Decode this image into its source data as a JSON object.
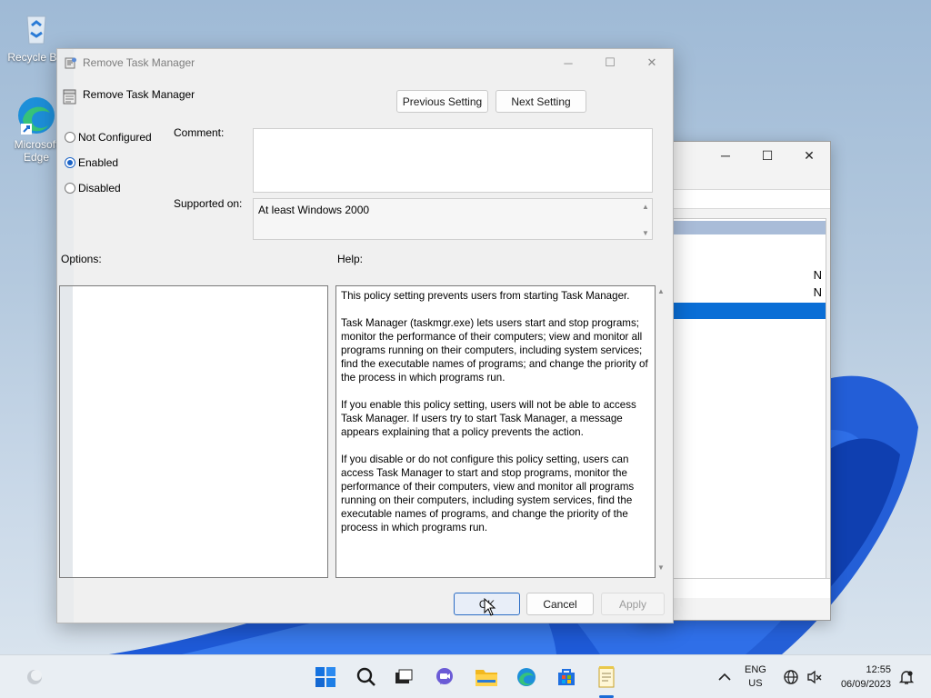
{
  "desktop": {
    "icons": [
      {
        "label": "Recycle Bin",
        "icon": "recycle-bin-icon"
      },
      {
        "label": "Microsoft Edge",
        "icon": "edge-icon"
      }
    ]
  },
  "background_window": {
    "rows": [
      "N",
      "N"
    ]
  },
  "dialog": {
    "title": "Remove Task Manager",
    "header_label": "Remove Task Manager",
    "buttons": {
      "previous": "Previous Setting",
      "next": "Next Setting",
      "ok": "OK",
      "cancel": "Cancel",
      "apply": "Apply"
    },
    "radios": [
      {
        "label": "Not Configured",
        "selected": false
      },
      {
        "label": "Enabled",
        "selected": true
      },
      {
        "label": "Disabled",
        "selected": false
      }
    ],
    "comment_label": "Comment:",
    "comment_value": "",
    "supported_label": "Supported on:",
    "supported_value": "At least Windows 2000",
    "options_label": "Options:",
    "help_label": "Help:",
    "help_paragraphs": [
      "This policy setting prevents users from starting Task Manager.",
      "Task Manager (taskmgr.exe) lets users start and stop programs; monitor the performance of their computers; view and monitor all programs running on their computers, including system services; find the executable names of programs; and change the priority of the process in which programs run.",
      "If you enable this policy setting, users will not be able to access Task Manager. If users try to start Task Manager, a message appears explaining that a policy prevents the action.",
      "If you disable or do not configure this policy setting, users can access Task Manager to  start and stop programs, monitor the performance of their computers, view and monitor all programs running on their computers, including system services, find the executable names of programs, and change the priority of the process in which programs run."
    ]
  },
  "taskbar": {
    "apps": [
      "start-icon",
      "search-icon",
      "task-view-icon",
      "chat-icon",
      "file-explorer-icon",
      "edge-icon",
      "store-icon",
      "notepad-icon"
    ],
    "language_top": "ENG",
    "language_bottom": "US",
    "time": "12:55",
    "date": "06/09/2023"
  },
  "colors": {
    "accent": "#1b63c6",
    "selection": "#0a6ed6"
  }
}
